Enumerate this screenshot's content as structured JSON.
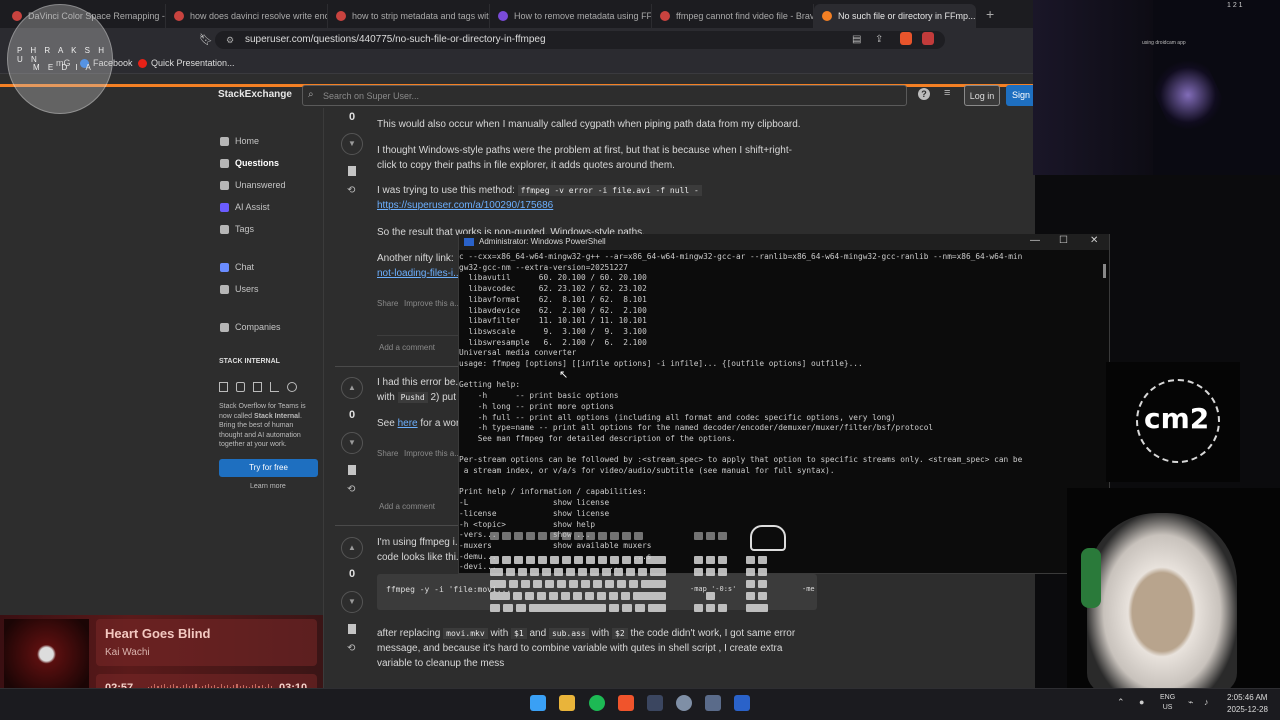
{
  "browser": {
    "tabs": [
      {
        "label": "DaVinci Color Space Remapping - B..."
      },
      {
        "label": "how does davinci resolve write enco..."
      },
      {
        "label": "how to strip metadata and tags with..."
      },
      {
        "label": "How to remove metadata using FFM..."
      },
      {
        "label": "ffmpeg cannot find video file - Brave..."
      },
      {
        "label": "No such file or directory in FFmp..."
      }
    ],
    "url": "superuser.com/questions/440775/no-such-file-or-directory-in-ffmpeg",
    "bookmarks": [
      "mG",
      "Facebook",
      "Quick Presentation..."
    ]
  },
  "stream_logo": {
    "line1": "P H R A K S H U N",
    "line2": "M E D I A"
  },
  "se": {
    "logo": "StackExchange",
    "search_placeholder": "Search on Super User...",
    "login": "Log in",
    "signup": "Sign"
  },
  "nav": {
    "items": [
      "Home",
      "Questions",
      "Unanswered",
      "AI Assist",
      "Tags",
      "Chat",
      "Users",
      "Companies"
    ],
    "section": "STACK INTERNAL",
    "promo_a": "Stack Overflow for Teams is now called ",
    "promo_b": "Stack Internal",
    "promo_c": ". Bring the best of human thought and AI automation together at your work.",
    "try_free": "Try for free",
    "learn_more": "Learn more"
  },
  "answers": {
    "a1": {
      "votes": "0",
      "p1": "This would also occur when I manually called cygpath when piping path data from my clipboard.",
      "p2a": "I thought Windows-style paths were the problem at first, but that is because when I shift+right-",
      "p2b": "click to copy their paths in file explorer, it adds quotes around them.",
      "p3": "I was trying to use this method:",
      "p3_code": "ffmpeg -v error -i file.avi -f null -",
      "p3_link": "https://superuser.com/a/100290/175686",
      "p4": "So the result that works is non-quoted, Windows-style paths.",
      "p5": "Another nifty link:",
      "p5_link": "not-loading-files-i...",
      "share": "Share",
      "improve": "Improve this a...",
      "comment": "Add a comment"
    },
    "a2": {
      "votes": "0",
      "p1": "I had this error be...",
      "p1b": "with",
      "p1_code": "Pushd",
      "p1c": "2) put",
      "p2": "See",
      "p2_link": "here",
      "p2b": "for a wor...",
      "share": "Share",
      "improve": "Improve this a...",
      "comment": "Add a comment"
    },
    "a3": {
      "votes": "0",
      "p1": "I'm using ffmpeg i...",
      "p1b": "code looks like thi...",
      "code": "ffmpeg -y -i 'file:movi...",
      "code_tail": "-map '-0:s'",
      "code_tail2": "-me",
      "p2a": "after replacing",
      "c1": "movi.mkv",
      "p2b": "with",
      "c2": "$1",
      "p2c": "and",
      "c3": "sub.ass",
      "p2d": "with",
      "c4": "$2",
      "p2e": "the code didn't work, I got same error",
      "p3": "message, and because it's hard to combine variable with qutes in shell script , I create extra",
      "p4": "variable to cleanup the mess"
    }
  },
  "powershell": {
    "title": "Administrator: Windows PowerShell",
    "output": "c --cxx=x86_64-w64-mingw32-g++ --ar=x86_64-w64-mingw32-gcc-ar --ranlib=x86_64-w64-mingw32-gcc-ranlib --nm=x86_64-w64-min\ngw32-gcc-nm --extra-version=20251227\n  libavutil      60. 20.100 / 60. 20.100\n  libavcodec     62. 23.102 / 62. 23.102\n  libavformat    62.  8.101 / 62.  8.101\n  libavdevice    62.  2.100 / 62.  2.100\n  libavfilter    11. 10.101 / 11. 10.101\n  libswscale      9.  3.100 /  9.  3.100\n  libswresample   6.  2.100 /  6.  2.100\nUniversal media converter\nusage: ffmpeg [options] [[infile options] -i infile]... {[outfile options] outfile}...\n\nGetting help:\n    -h      -- print basic options\n    -h long -- print more options\n    -h full -- print all options (including all format and codec specific options, very long)\n    -h type=name -- print all options for the named decoder/encoder/demuxer/muxer/filter/bsf/protocol\n    See man ffmpeg for detailed description of the options.\n\nPer-stream options can be followed by :<stream_spec> to apply that option to specific streams only. <stream_spec> can be\n a stream index, or v/a/s for video/audio/subtitle (see manual for full syntax).\n\nPrint help / information / capabilities:\n-L                  show license\n-license            show license\n-h <topic>          show help\n-vers...            show ...\n-muxers             show available muxers\n-demu...                             ...s\n-devi...                        ..."
  },
  "overlay": {
    "cam_label": "using droidcam app",
    "cam_status": "1  2  1",
    "cm_logo": "cm2"
  },
  "music": {
    "song": "Heart Goes Blind",
    "artist": "Kai Wachi",
    "current": "02:57",
    "total": "03:10",
    "progress": 0.93
  },
  "taskbar": {
    "lang1": "ENG",
    "lang2": "US",
    "time": "2:05:46 AM",
    "date": "2025-12-28"
  }
}
